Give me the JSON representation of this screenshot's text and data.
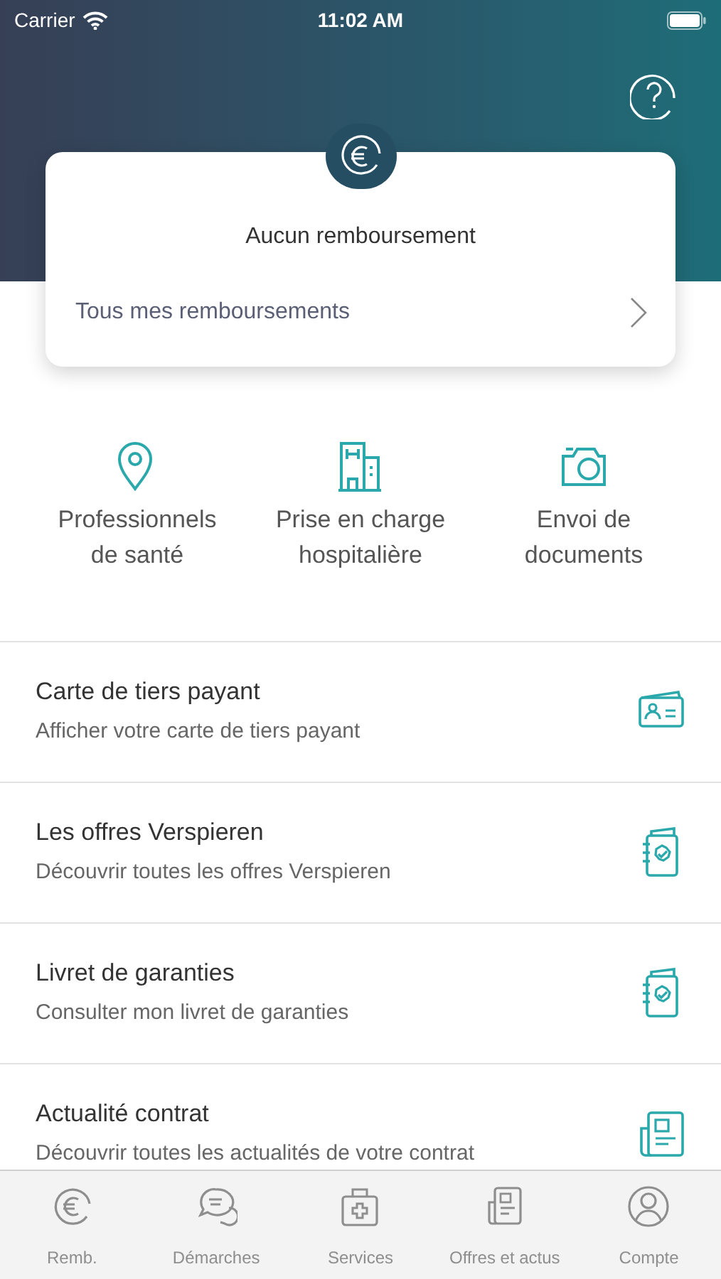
{
  "status_bar": {
    "carrier": "Carrier",
    "time": "11:02 AM"
  },
  "summary_card": {
    "message": "Aucun remboursement",
    "link": "Tous mes remboursements"
  },
  "quick_actions": [
    {
      "kind": "pin",
      "lines": [
        "Professionnels",
        "de santé"
      ]
    },
    {
      "kind": "hospital",
      "lines": [
        "Prise en charge",
        "hospitalière"
      ]
    },
    {
      "kind": "camera",
      "lines": [
        "Envoi de",
        "documents"
      ]
    }
  ],
  "list": [
    {
      "kind": "card",
      "title": "Carte de tiers payant",
      "subtitle": "Afficher votre carte de tiers payant"
    },
    {
      "kind": "booklet",
      "title": "Les offres Verspieren",
      "subtitle": "Découvrir toutes les offres Verspieren"
    },
    {
      "kind": "booklet",
      "title": "Livret de garanties",
      "subtitle": "Consulter mon livret de garanties"
    },
    {
      "kind": "news",
      "title": "Actualité contrat",
      "subtitle": "Découvrir toutes les actualités de votre contrat"
    }
  ],
  "tab_bar": [
    {
      "kind": "euro",
      "label": "Remb.",
      "selected": false
    },
    {
      "kind": "chat",
      "label": "Démarches",
      "selected": false
    },
    {
      "kind": "kit",
      "label": "Services",
      "selected": false
    },
    {
      "kind": "news",
      "label": "Offres et actus",
      "selected": false
    },
    {
      "kind": "user",
      "label": "Compte",
      "selected": false
    }
  ]
}
